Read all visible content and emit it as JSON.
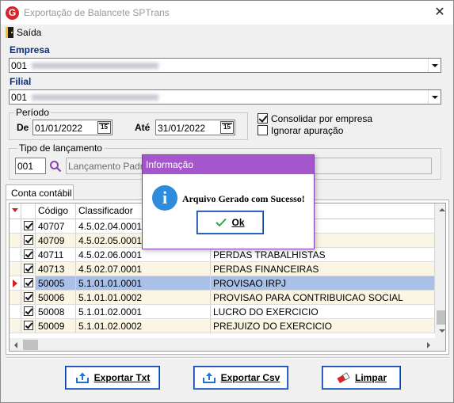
{
  "window": {
    "title": "Exportação de Balancete SPTrans",
    "close_glyph": "✕"
  },
  "app_icon": {
    "letter": "G"
  },
  "menu": {
    "exit_label": "Saída"
  },
  "empresa": {
    "label": "Empresa",
    "value": "001"
  },
  "filial": {
    "label": "Filial",
    "value": "001"
  },
  "periodo": {
    "group_label": "Período",
    "de_label": "De",
    "de_value": "01/01/2022",
    "ate_label": "Até",
    "ate_value": "31/01/2022",
    "calendar_glyph": "15"
  },
  "options": {
    "consolidar_label": "Consolidar por empresa",
    "consolidar_checked": true,
    "ignorar_label": "Ignorar apuração",
    "ignorar_checked": false
  },
  "tipo_lancamento": {
    "group_label": "Tipo de lançamento",
    "code": "001",
    "description": "Lançamento Padrão"
  },
  "tab": {
    "label": "Conta contábil"
  },
  "grid": {
    "headers": {
      "codigo": "Código",
      "classificador": "Classificador"
    },
    "rows": [
      {
        "code": "40707",
        "class": "4.5.02.04.0001",
        "desc": "",
        "checked": true
      },
      {
        "code": "40709",
        "class": "4.5.02.05.0001",
        "desc": "",
        "checked": true
      },
      {
        "code": "40711",
        "class": "4.5.02.06.0001",
        "desc": "PERDAS TRABALHISTAS",
        "checked": true
      },
      {
        "code": "40713",
        "class": "4.5.02.07.0001",
        "desc": "PERDAS FINANCEIRAS",
        "checked": true
      },
      {
        "code": "50005",
        "class": "5.1.01.01.0001",
        "desc": "PROVISAO IRPJ",
        "checked": true,
        "selected": true
      },
      {
        "code": "50006",
        "class": "5.1.01.01.0002",
        "desc": "PROVISAO PARA CONTRIBUICAO SOCIAL",
        "checked": true
      },
      {
        "code": "50008",
        "class": "5.1.01.02.0001",
        "desc": "LUCRO DO EXERCICIO",
        "checked": true
      },
      {
        "code": "50009",
        "class": "5.1.01.02.0002",
        "desc": "PREJUIZO DO EXERCICIO",
        "checked": true
      }
    ]
  },
  "buttons": {
    "export_txt": "Exportar Txt",
    "export_csv": "Exportar Csv",
    "limpar": "Limpar"
  },
  "dialog": {
    "title": "Informação",
    "message": "Arquivo Gerado com Sucesso!",
    "icon_glyph": "i",
    "ok_label": "Ok"
  },
  "colors": {
    "dialog_title": "#a556cc",
    "selected_row": "#a9c0e8",
    "alt_row": "#fbf5e3",
    "label_blue": "#0b2e7a"
  }
}
